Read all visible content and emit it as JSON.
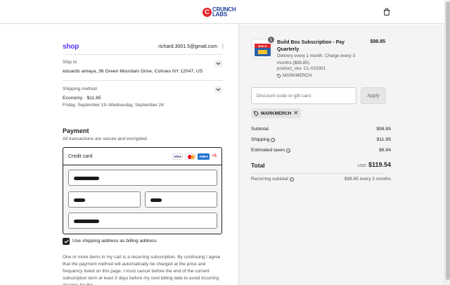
{
  "header": {
    "brand_line1": "CRUNCH",
    "brand_line2": "LABS",
    "brand_mark": "C",
    "cart_icon": "shopping-bag-icon"
  },
  "contact": {
    "shop_pay_label": "shop",
    "email": "richard.3001.5@gmail.com",
    "menu_icon": "kebab-menu-icon"
  },
  "ship_to": {
    "label": "Ship to",
    "address": "eduardo amaya, 36 Green Mountain Drive, Cohoes NY 12047, US"
  },
  "shipping_method": {
    "label": "Shipping method",
    "value": "Economy · $11.85",
    "dates": "Friday, September 19–Wednesday, September 24"
  },
  "payment": {
    "title": "Payment",
    "subtitle": "All transactions are secure and encrypted.",
    "method_label": "Credit card",
    "brands": [
      "VISA",
      "Mastercard",
      "AMEX"
    ],
    "more_brands": "+5",
    "card_number": "••••••••",
    "expiry": "•••••",
    "security_code": "•••••",
    "name_on_card": "••••••••••"
  },
  "billing": {
    "checkbox_checked": true,
    "label": "Use shipping address as billing address"
  },
  "legal_text": "One or more items in my cart is a recurring subscription. By continuing I agree that the payment method will automatically be charged at the price and frequency listed on this page. I must cancel before the end of the current subscription term at least 3 days before my next billing date to avoid incurring charges for the",
  "order": {
    "item": {
      "quantity": "1",
      "title": "Build Box Subscription - Pay Quarterly",
      "price": "$98.85",
      "description": "Delivery every 1 month. Charge every 3 months ($98.85).",
      "sku": "product_sku: CL-010001",
      "discount_code": "MARKMERCH",
      "image_text": "BUILD"
    },
    "discount_placeholder": "Discount code or gift card",
    "apply_label": "Apply",
    "applied_code": "MARKMERCH",
    "subtotal_label": "Subtotal",
    "subtotal": "$98.85",
    "shipping_label": "Shipping",
    "shipping": "$11.85",
    "taxes_label": "Estimated taxes",
    "taxes": "$8.84",
    "total_label": "Total",
    "currency": "USD",
    "total": "$119.54",
    "recurring_label": "Recurring subtotal",
    "recurring": "$98.85 every 3 months"
  },
  "colors": {
    "brand_red": "#e0262c",
    "brand_blue": "#1f3f9a",
    "shop_purple": "#5a31f4",
    "summary_bg": "#f4f4f4"
  }
}
